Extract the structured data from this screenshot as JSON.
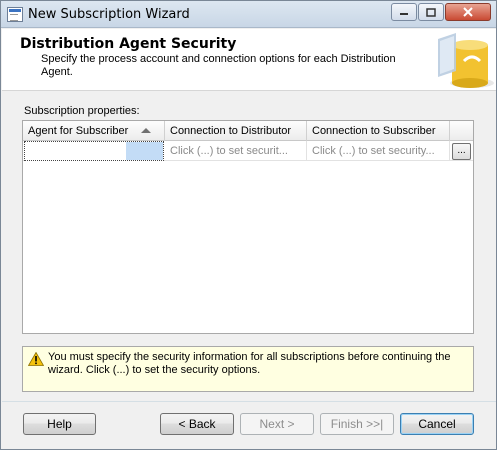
{
  "window": {
    "title": "New Subscription Wizard",
    "controls": {
      "minimize_icon": "minimize-icon",
      "maximize_icon": "maximize-icon",
      "close_icon": "close-icon"
    }
  },
  "header": {
    "title": "Distribution Agent Security",
    "subtitle": "Specify the process account and connection options for each Distribution Agent.",
    "logo_icon": "database-icon"
  },
  "subscription_properties": {
    "label": "Subscription properties:",
    "columns": [
      "Agent for Subscriber",
      "Connection to Distributor",
      "Connection to Subscriber"
    ],
    "rows": [
      {
        "agent": "",
        "distributor": "Click (...) to set securit...",
        "subscriber": "Click (...) to set security...",
        "button": "..."
      }
    ]
  },
  "warning": {
    "icon": "warning-icon",
    "text": "You must specify the security information for all subscriptions before continuing the wizard. Click (...) to set the security options."
  },
  "buttons": {
    "help": "Help",
    "back": "< Back",
    "next": "Next >",
    "finish": "Finish >>|",
    "cancel": "Cancel"
  },
  "colors": {
    "warning_bg": "#ffffe1",
    "selection": "#c3dcf6",
    "accent_logo": "#f2c230"
  }
}
